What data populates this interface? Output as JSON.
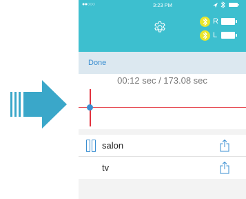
{
  "status": {
    "signal": "●●○○○",
    "time": "3:23 PM"
  },
  "devices": [
    {
      "side": "R",
      "icon": "bluetooth-icon"
    },
    {
      "side": "L",
      "icon": "bluetooth-icon"
    }
  ],
  "toolbar": {
    "done_label": "Done"
  },
  "player": {
    "timecode": "00:12 sec / 173.08 sec"
  },
  "recordings": [
    {
      "label": "salon",
      "state_icon": "pause-icon",
      "action_icon": "share-icon"
    },
    {
      "label": "tv",
      "action_icon": "share-icon"
    }
  ],
  "colors": {
    "header": "#3dbfcf",
    "accent": "#3b8fd1",
    "cursor": "#e2303c",
    "bluetooth": "#e9e62c",
    "arrow": "#3aa7c9"
  }
}
